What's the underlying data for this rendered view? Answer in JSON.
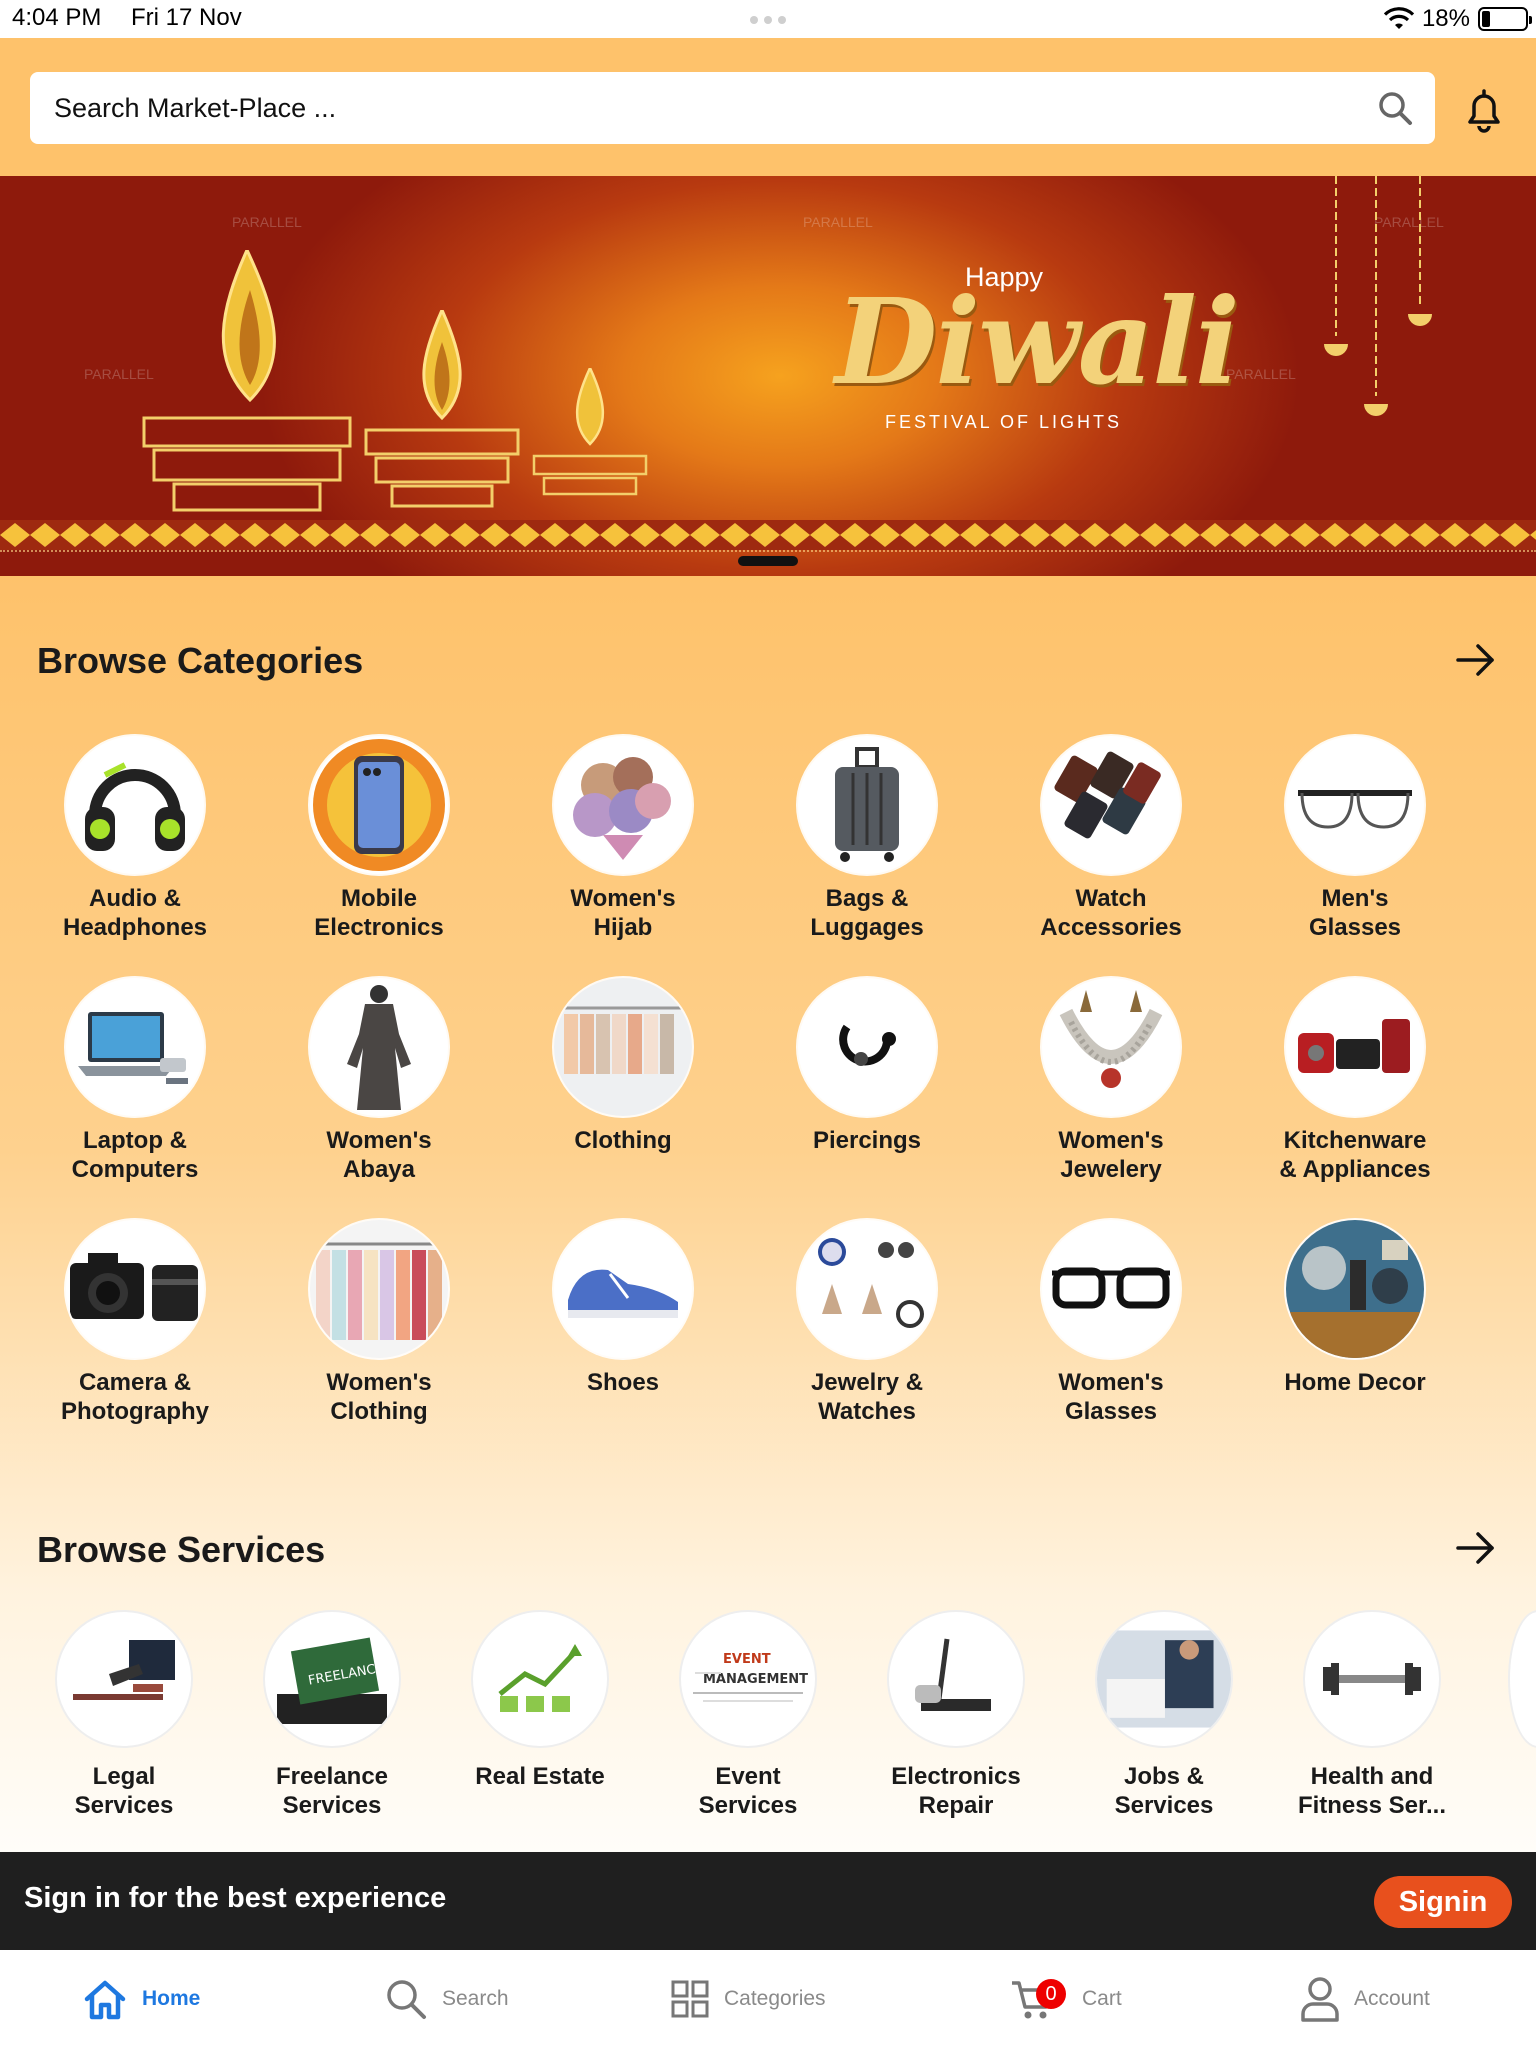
{
  "status_bar": {
    "time": "4:04 PM",
    "date": "Fri 17 Nov",
    "battery": "18%",
    "battery_level": 0.18
  },
  "header": {
    "search_placeholder": "Search Market-Place ...",
    "background_color": "#fec26b"
  },
  "banner": {
    "happy": "Happy",
    "title": "Diwali",
    "subtitle": "FESTIVAL OF LIGHTS",
    "watermark": "PARALLEL"
  },
  "categories": {
    "title": "Browse Categories",
    "items": [
      {
        "label": "Audio &\nHeadphones",
        "icon": "headphones-icon"
      },
      {
        "label": "Mobile\nElectronics",
        "icon": "smartphone-icon"
      },
      {
        "label": "Women's\nHijab",
        "icon": "hijab-icon"
      },
      {
        "label": "Bags &\nLuggages",
        "icon": "suitcase-icon"
      },
      {
        "label": "Watch\nAccessories",
        "icon": "watch-strap-icon"
      },
      {
        "label": "Men's\nGlasses",
        "icon": "glasses-icon"
      },
      {
        "label": "Laptop &\nComputers",
        "icon": "laptop-icon"
      },
      {
        "label": "Women's\nAbaya",
        "icon": "abaya-icon"
      },
      {
        "label": "Clothing",
        "icon": "clothes-rack-icon"
      },
      {
        "label": "Piercings",
        "icon": "piercing-icon"
      },
      {
        "label": "Women's\nJewelery",
        "icon": "necklace-icon"
      },
      {
        "label": "Kitchenware\n& Appliances",
        "icon": "kitchen-appliance-icon"
      },
      {
        "label": "Camera &\nPhotography",
        "icon": "camera-icon"
      },
      {
        "label": "Women's\nClothing",
        "icon": "clothing-rack-icon"
      },
      {
        "label": "Shoes",
        "icon": "sneaker-icon"
      },
      {
        "label": "Jewelry &\nWatches",
        "icon": "jewelry-watch-icon"
      },
      {
        "label": "Women's\nGlasses",
        "icon": "black-glasses-icon"
      },
      {
        "label": "Home Decor",
        "icon": "home-decor-icon"
      }
    ]
  },
  "services": {
    "title": "Browse Services",
    "items": [
      {
        "label": "Legal\nServices",
        "icon": "legal-icon"
      },
      {
        "label": "Freelance\nServices",
        "icon": "freelance-icon",
        "badge_text": "FREELANCE"
      },
      {
        "label": "Real Estate",
        "icon": "real-estate-icon"
      },
      {
        "label": "Event\nServices",
        "icon": "event-icon",
        "badge_text": "EVENT MANAGEMENT"
      },
      {
        "label": "Electronics\nRepair",
        "icon": "electronics-repair-icon"
      },
      {
        "label": "Jobs &\nServices",
        "icon": "jobs-icon"
      },
      {
        "label": "Health and\nFitness Ser...",
        "icon": "dumbbell-icon"
      }
    ]
  },
  "signin": {
    "text": "Sign in for the best experience",
    "button": "Signin",
    "button_color": "#e8501d"
  },
  "tabs": [
    {
      "label": "Home",
      "icon": "home-icon",
      "active": true
    },
    {
      "label": "Search",
      "icon": "search-icon"
    },
    {
      "label": "Categories",
      "icon": "grid-icon"
    },
    {
      "label": "Cart",
      "icon": "cart-icon",
      "badge": "0"
    },
    {
      "label": "Account",
      "icon": "user-icon"
    }
  ],
  "colors": {
    "active_tab": "#1e78e0",
    "cart_badge": "#e00000"
  }
}
